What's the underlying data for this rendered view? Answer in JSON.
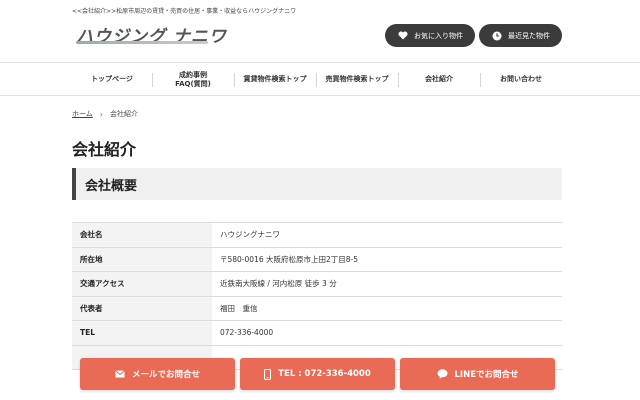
{
  "header": {
    "tagline": "<<会社紹介>>松原市周辺の賃貸・売買の住居・事業・収益ならハウジングナニワ",
    "logo_text": "ハウジング ナニワ",
    "favorites_label": "お気に入り物件",
    "recent_label": "最近見た物件"
  },
  "nav": {
    "items": [
      {
        "label": "トップページ"
      },
      {
        "label": "成約事例\nFAQ(質問)"
      },
      {
        "label": "賃貸物件検索トップ"
      },
      {
        "label": "売買物件検索トップ"
      },
      {
        "label": "会社紹介"
      },
      {
        "label": "お問い合わせ"
      }
    ]
  },
  "breadcrumb": {
    "home": "ホーム",
    "separator": "›",
    "current": "会社紹介"
  },
  "page": {
    "title": "会社紹介",
    "section_title": "会社概要"
  },
  "company_table": {
    "rows": [
      {
        "label": "会社名",
        "value": "ハウジングナニワ"
      },
      {
        "label": "所在地",
        "value": "〒580-0016 大阪府松原市上田2丁目8-5"
      },
      {
        "label": "交通アクセス",
        "value": "近鉄南大阪線 / 河内松原 徒歩 3 分"
      },
      {
        "label": "代表者",
        "value": "福田　重信"
      },
      {
        "label": "TEL",
        "value": "072-336-4000"
      },
      {
        "label": "",
        "value": ""
      }
    ]
  },
  "cta": {
    "mail_label": "メールでお問合せ",
    "tel_label": "TEL : 072-336-4000",
    "line_label": "LINEでお問合せ"
  },
  "colors": {
    "accent": "#e96a55",
    "header_button": "#3b3b3b",
    "section_bar": "#444444"
  },
  "icons": {
    "favorites": "heart-icon",
    "recent": "clock-icon",
    "mail": "mail-icon",
    "tel": "phone-icon",
    "line": "chat-icon",
    "breadcrumb_sep": "chevron-right-icon"
  }
}
